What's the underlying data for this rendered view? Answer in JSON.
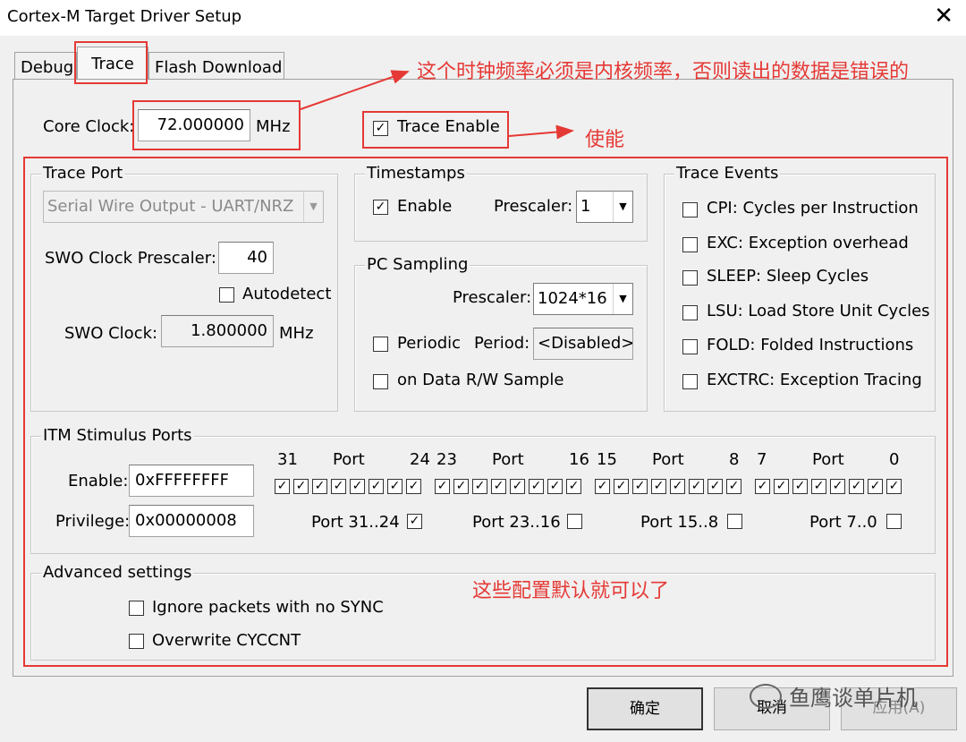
{
  "window": {
    "title": "Cortex-M Target Driver Setup",
    "close_glyph": "✕"
  },
  "tabs": [
    {
      "label": "Debug"
    },
    {
      "label": "Trace"
    },
    {
      "label": "Flash Download"
    }
  ],
  "core_clock": {
    "label": "Core Clock:",
    "value": "72.000000",
    "unit": "MHz"
  },
  "trace_enable": {
    "label": "Trace Enable",
    "checked": true
  },
  "trace_port": {
    "legend": "Trace Port",
    "port_select": "Serial Wire Output - UART/NRZ",
    "swo_prescaler_label": "SWO Clock Prescaler:",
    "swo_prescaler_value": "40",
    "autodetect_label": "Autodetect",
    "swo_clock_label": "SWO Clock:",
    "swo_clock_value": "1.800000",
    "swo_clock_unit": "MHz"
  },
  "timestamps": {
    "legend": "Timestamps",
    "enable_label": "Enable",
    "prescaler_label": "Prescaler:",
    "prescaler_value": "1"
  },
  "pc_sampling": {
    "legend": "PC Sampling",
    "prescaler_label": "Prescaler:",
    "prescaler_value": "1024*16",
    "periodic_label": "Periodic",
    "period_label": "Period:",
    "period_value": "<Disabled>",
    "data_rw_label": "on Data R/W Sample"
  },
  "trace_events": {
    "legend": "Trace Events",
    "items": [
      "CPI: Cycles per Instruction",
      "EXC: Exception overhead",
      "SLEEP: Sleep Cycles",
      "LSU: Load Store Unit Cycles",
      "FOLD: Folded Instructions",
      "EXCTRC: Exception Tracing"
    ]
  },
  "itm": {
    "legend": "ITM Stimulus Ports",
    "enable_label": "Enable:",
    "enable_value": "0xFFFFFFFF",
    "privilege_label": "Privilege:",
    "privilege_value": "0x00000008",
    "headers": [
      {
        "hi": "31",
        "port": "Port",
        "lo": "24"
      },
      {
        "hi": "23",
        "port": "Port",
        "lo": "16"
      },
      {
        "hi": "15",
        "port": "Port",
        "lo": "8"
      },
      {
        "hi": "7",
        "port": "Port",
        "lo": "0"
      }
    ],
    "privilege_groups": [
      {
        "label": "Port 31..24",
        "checked": true
      },
      {
        "label": "Port 23..16",
        "checked": false
      },
      {
        "label": "Port 15..8",
        "checked": false
      },
      {
        "label": "Port 7..0",
        "checked": false
      }
    ]
  },
  "advanced": {
    "legend": "Advanced settings",
    "ignore_sync_label": "Ignore packets with no SYNC",
    "overwrite_label": "Overwrite CYCCNT"
  },
  "buttons": {
    "ok": "确定",
    "cancel": "取消",
    "apply": "应用(A)"
  },
  "annotations": {
    "clock_note": "这个时钟频率必须是内核频率，否则读出的数据是错误的",
    "enable_note": "使能",
    "default_note": "这些配置默认就可以了",
    "watermark": "鱼鹰谈单片机"
  },
  "colors": {
    "annotation_red": "#e53935",
    "background": "#f0f0f0"
  }
}
